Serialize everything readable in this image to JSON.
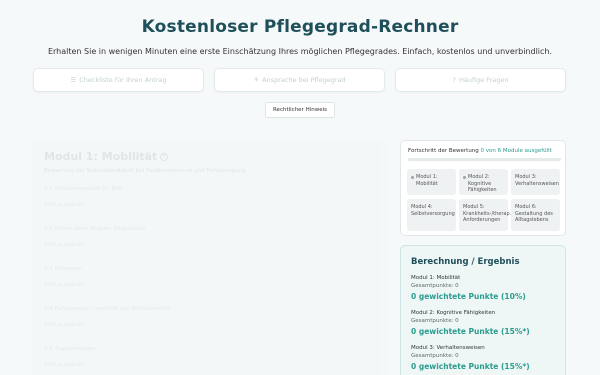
{
  "header": {
    "title": "Kostenloser Pflegegrad-Rechner",
    "subtitle": "Erhalten Sie in wenigen Minuten eine erste Einschätzung Ihres möglichen Pflegegrades. Einfach, kostenlos und unverbindlich."
  },
  "tabs": [
    {
      "icon": "checklist-icon",
      "glyph": "☰",
      "label": "Checkliste für Ihren Antrag"
    },
    {
      "icon": "contact-icon",
      "glyph": "⚘",
      "label": "Ansprache bei Pflegegrad"
    },
    {
      "icon": "question-icon",
      "glyph": "?",
      "label": "Häufige Fragen"
    }
  ],
  "legal_hint_label": "Rechtlicher Hinweis",
  "module": {
    "title": "Modul 1: Mobilität",
    "description": "Bewertung der Selbstständigkeit bei Positionswechsel und Fortbewegung",
    "questions": [
      {
        "label": "1.1 Positionswechsel im Bett",
        "select": "Bitte auswählen"
      },
      {
        "label": "1.2 Halten einer stabilen Sitzposition",
        "select": "Bitte auswählen"
      },
      {
        "label": "1.3 Umsetzen",
        "select": "Bitte auswählen"
      },
      {
        "label": "1.4 Fortbewegen innerhalb des Wohnbereichs",
        "select": "Bitte auswählen"
      },
      {
        "label": "1.5 Treppensteigen",
        "select": "Bitte auswählen"
      }
    ]
  },
  "progress": {
    "label": "Fortschritt der Bewertung",
    "status": "0 von 6 Module ausgefüllt",
    "fraction": 0,
    "modules": [
      {
        "label": "Modul 1: Mobilität"
      },
      {
        "label": "Modul 2: Kognitive Fähigkeiten"
      },
      {
        "label": "Modul 3: Verhaltensweisen"
      },
      {
        "label": "Modul 4: Selbstversorgung"
      },
      {
        "label": "Modul 5: Krankheits-/therap. Anforderungen"
      },
      {
        "label": "Modul 6: Gestaltung des Alltagslebens"
      }
    ]
  },
  "result": {
    "title": "Berechnung / Ergebnis",
    "items": [
      {
        "name": "Modul 1: Mobilität",
        "sum": "Gesamtpunkte: 0",
        "points": "0 gewichtete Punkte (10%)"
      },
      {
        "name": "Modul 2: Kognitive Fähigkeiten",
        "sum": "Gesamtpunkte: 0",
        "points": "0 gewichtete Punkte (15%*)"
      },
      {
        "name": "Modul 3: Verhaltensweisen",
        "sum": "Gesamtpunkte: 0",
        "points": "0 gewichtete Punkte (15%*)"
      }
    ]
  },
  "colors": {
    "accent": "#2a9d8f",
    "heading": "#1f4f5a",
    "background": "#f6f9fa"
  }
}
